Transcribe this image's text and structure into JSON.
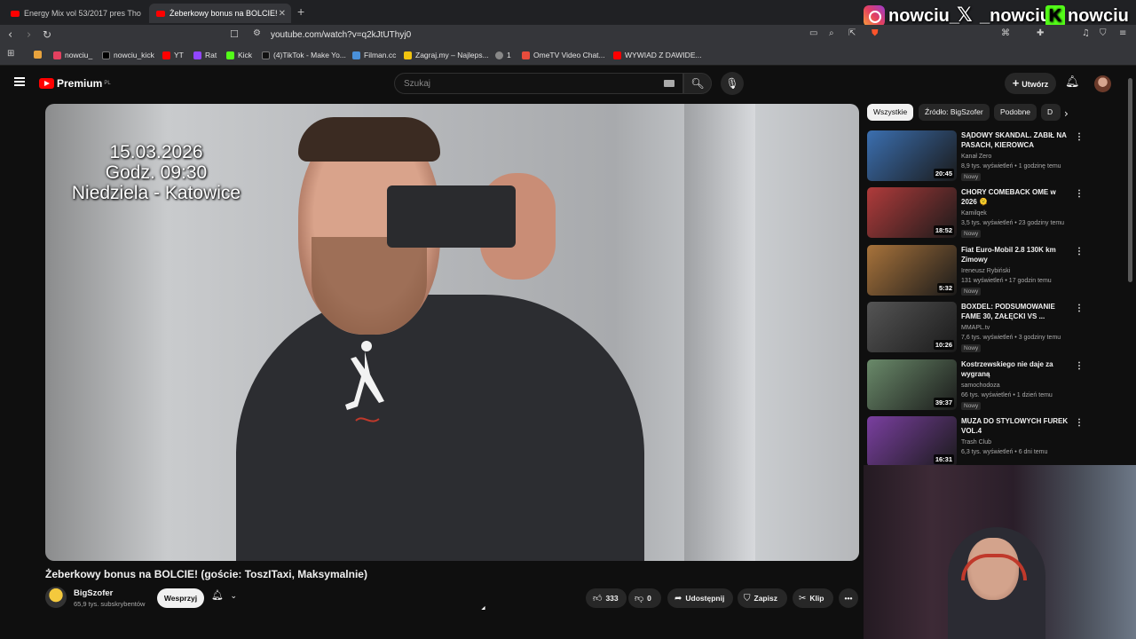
{
  "browser": {
    "tabs": [
      {
        "title": "Energy Mix vol 53/2017 pres Tho"
      },
      {
        "title": "Żeberkowy bonus na BOLCIE!"
      }
    ],
    "new_tab_icon": "plus-icon",
    "url": "youtube.com/watch?v=q2kJtUThyj0",
    "bookmarks": [
      {
        "label": "",
        "icon": "#e8a33d"
      },
      {
        "label": "nowciu_",
        "icon": "#e4405f"
      },
      {
        "label": "nowciu_kick",
        "icon": "#000000"
      },
      {
        "label": "YT",
        "icon": "#ff0000"
      },
      {
        "label": "Rat",
        "icon": "#9146ff"
      },
      {
        "label": "Kick",
        "icon": "#53fc18"
      },
      {
        "label": "(4)TikTok - Make Yo...",
        "icon": "#111111"
      },
      {
        "label": "Filman.cc",
        "icon": "#4a90d9"
      },
      {
        "label": "Zagraj.my – Najleps...",
        "icon": "#f1c40f"
      },
      {
        "label": "1",
        "icon": "#888888"
      },
      {
        "label": "OmeTV Video Chat...",
        "icon": "#e74c3c"
      },
      {
        "label": "WYWIAD Z DAWIDE...",
        "icon": "#ff0000"
      }
    ]
  },
  "overlay_socials": [
    {
      "handle": "nowciu_",
      "icon": "instagram-icon"
    },
    {
      "handle": "_nowciu",
      "icon": "x-icon"
    },
    {
      "handle": "nowciu",
      "icon": "kick-icon"
    }
  ],
  "youtube": {
    "logo_text": "Premium",
    "logo_region": "PL",
    "search_placeholder": "Szukaj",
    "create_label": "Utwórz",
    "video": {
      "overlay_lines": [
        "15.03.2026",
        "Godz. 09:30",
        "Niedziela - Katowice"
      ],
      "title": "Żeberkowy bonus na BOLCIE! (goście: ToszITaxi, Maksymalnie)",
      "channel": "BigSzofer",
      "subscribers": "65,9 tys. subskrybentów",
      "support_label": "Wesprzyj",
      "likes": "333",
      "dislikes": "0",
      "share_label": "Udostępnij",
      "save_label": "Zapisz",
      "clip_label": "Klip"
    },
    "chips": [
      "Wszystkie",
      "Źródło: BigSzofer",
      "Podobne",
      "D"
    ],
    "recommendations": [
      {
        "title": "SĄDOWY SKANDAL. ZABIŁ NA PASACH, KIEROWCA NIEWINNY",
        "channel": "Kanał Zero",
        "meta": "8,9 tys. wyświetleń • 1 godzinę temu",
        "badge": "Nowy",
        "duration": "20:45",
        "color": "#3b6fb0"
      },
      {
        "title": "CHORY COMEBACK OME w 2026 🫠",
        "channel": "Kamilqek",
        "meta": "3,5 tys. wyświetleń • 23 godziny temu",
        "badge": "Nowy",
        "duration": "18:52",
        "color": "#b03b3b"
      },
      {
        "title": "Fiat Euro-Mobil 2.8 130K km Zimowy",
        "channel": "Ireneusz Rybiński",
        "meta": "131 wyświetleń • 17 godzin temu",
        "badge": "Nowy",
        "duration": "5:32",
        "color": "#a8733b"
      },
      {
        "title": "BOXDEL: PODSUMOWANIE FAME 30, ZAŁĘCKI VS ...",
        "channel": "MMAPL.tv",
        "meta": "7,6 tys. wyświetleń • 3 godziny temu",
        "badge": "Nowy",
        "duration": "10:26",
        "color": "#555555"
      },
      {
        "title": "Kostrzewskiego nie daje za wygraną",
        "channel": "samochodoza",
        "meta": "66 tys. wyświetleń • 1 dzień temu",
        "badge": "Nowy",
        "duration": "39:37",
        "color": "#6a8a6a"
      },
      {
        "title": "MUZA DO STYLOWYCH FUREK VOL.4",
        "channel": "Trash Club",
        "meta": "6,3 tys. wyświetleń • 6 dni temu",
        "badge": "",
        "duration": "16:31",
        "color": "#7a3fa0"
      }
    ]
  }
}
